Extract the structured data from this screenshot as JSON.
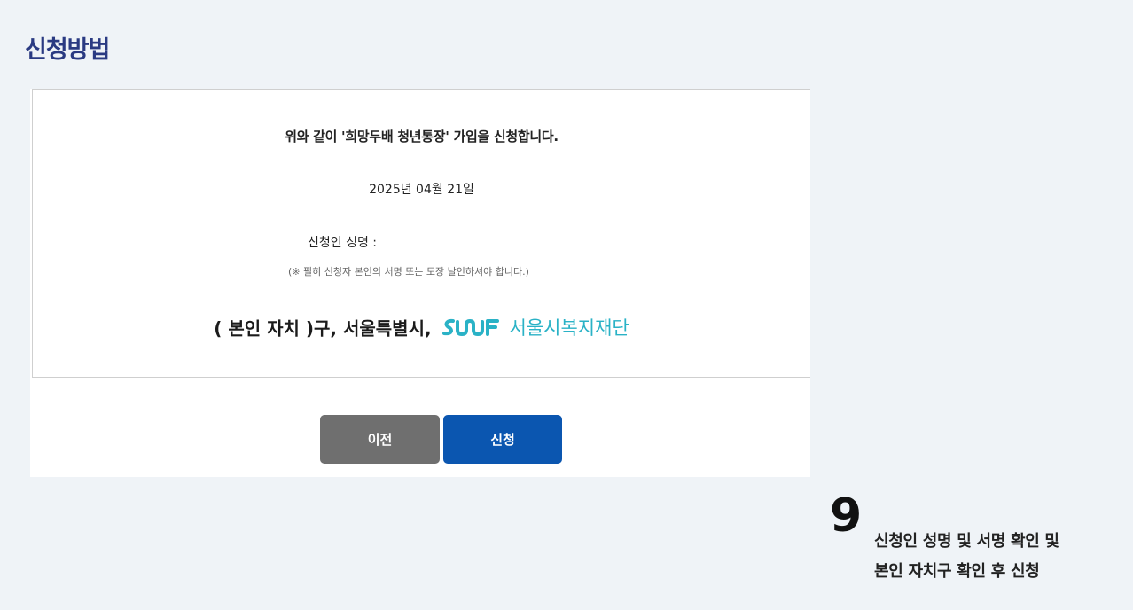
{
  "header": {
    "title": "신청방법"
  },
  "form": {
    "statement": "위와 같이 '희망두배 청년통장' 가입을 신청합니다.",
    "date": "2025년 04월 21일",
    "name_label": "신청인 성명 :",
    "notice": "(※ 필히 신청자 본인의 서명 또는 도장 날인하셔야 합니다.)",
    "addressee_prefix": "( 본인 자치 )구, 서울특별시,",
    "foundation_logo_text": "SWF",
    "foundation_name": "서울시복지재단"
  },
  "buttons": {
    "prev_label": "이전",
    "apply_label": "신청"
  },
  "step": {
    "number": "9",
    "line1": "신청인 성명 및 서명 확인 및",
    "line2": "본인 자치구 확인 후 신청"
  },
  "colors": {
    "background": "#eff3f7",
    "title": "#2a3a82",
    "prev_button": "#6f6f6f",
    "apply_button": "#0b56b0",
    "foundation_accent": "#2ab2c6"
  }
}
